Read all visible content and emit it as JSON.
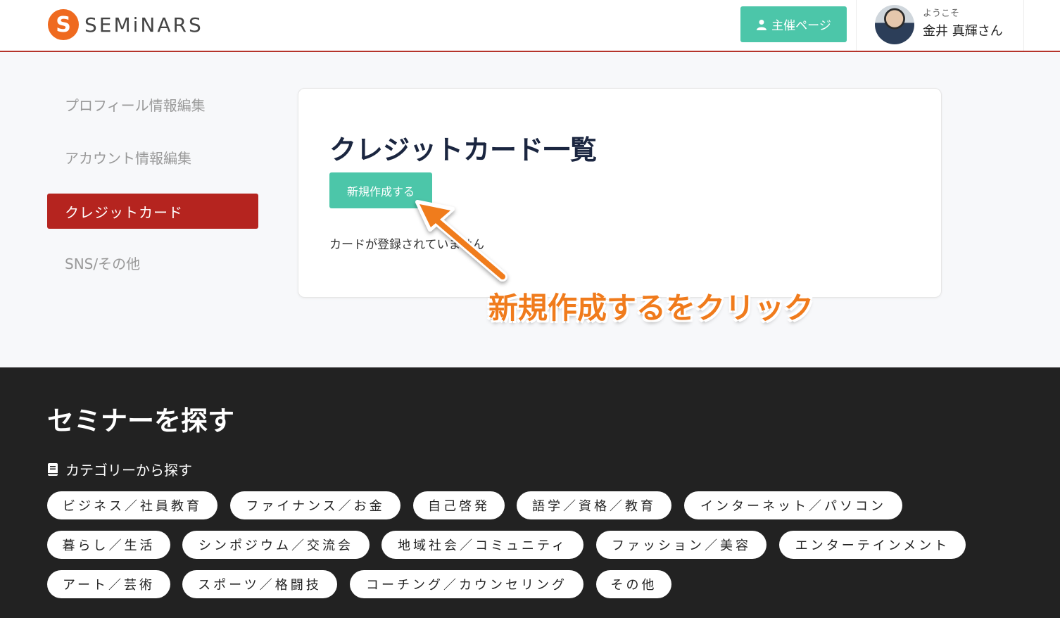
{
  "header": {
    "logo_text": "SEMiNARS",
    "logo_mark": "S",
    "host_button": "主催ページ",
    "welcome": "ようこそ",
    "username": "金井 真輝さん"
  },
  "sidebar": {
    "items": [
      {
        "label": "プロフィール情報編集"
      },
      {
        "label": "アカウント情報編集"
      },
      {
        "label": "クレジットカード"
      },
      {
        "label": "SNS/その他"
      }
    ]
  },
  "main": {
    "title": "クレジットカード一覧",
    "new_button": "新規作成する",
    "empty_message": "カードが登録されていません"
  },
  "annotation": {
    "text": "新規作成するをクリック",
    "color": "#f07b1c"
  },
  "footer": {
    "title": "セミナーを探す",
    "category_heading": "カテゴリーから探す",
    "categories": [
      "ビジネス／社員教育",
      "ファイナンス／お金",
      "自己啓発",
      "語学／資格／教育",
      "インターネット／パソコン",
      "暮らし／生活",
      "シンポジウム／交流会",
      "地域社会／コミュニティ",
      "ファッション／美容",
      "エンターテインメント",
      "アート／芸術",
      "スポーツ／格闘技",
      "コーチング／カウンセリング",
      "その他"
    ]
  },
  "colors": {
    "accent_green": "#4cc6a9",
    "accent_red": "#b5241f",
    "footer_bg": "#222222"
  }
}
